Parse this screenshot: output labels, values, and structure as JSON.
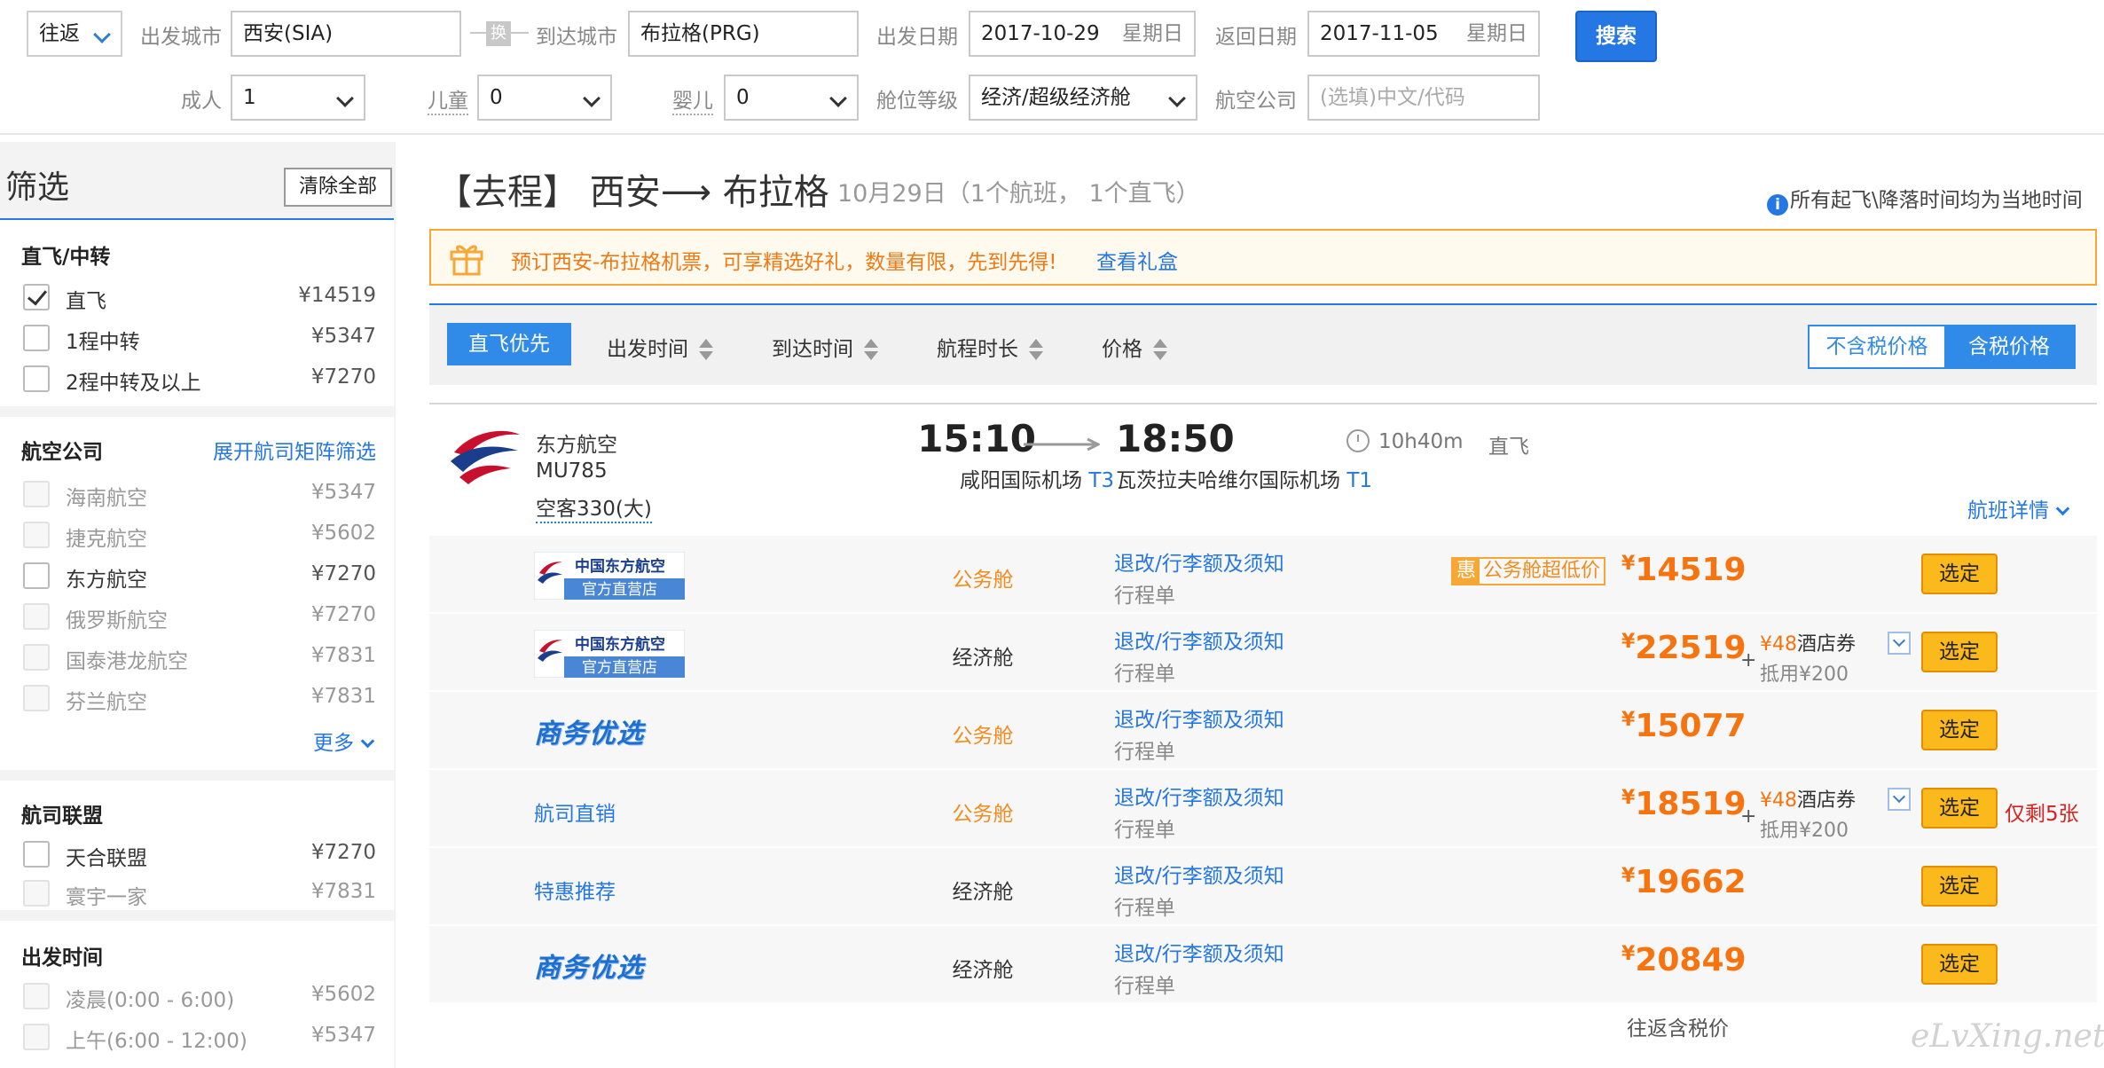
{
  "search": {
    "trip_type": "往返",
    "from_label": "出发城市",
    "from_value": "西安(SIA)",
    "swap_glyph": "换",
    "to_label": "到达城市",
    "to_value": "布拉格(PRG)",
    "depart_label": "出发日期",
    "depart_date": "2017-10-29",
    "depart_weekday": "星期日",
    "return_label": "返回日期",
    "return_date": "2017-11-05",
    "return_weekday": "星期日",
    "search_button": "搜索",
    "adult_label": "成人",
    "adult_value": "1",
    "child_label": "儿童",
    "child_value": "0",
    "infant_label": "婴儿",
    "infant_value": "0",
    "cabin_label": "舱位等级",
    "cabin_value": "经济/超级经济舱",
    "airline_label": "航空公司",
    "airline_placeholder": "(选填)中文/代码"
  },
  "sidebar": {
    "title": "筛选",
    "clear_all": "清除全部",
    "stops": {
      "title": "直飞/中转",
      "items": [
        {
          "label": "直飞",
          "price": "¥14519",
          "checked": true
        },
        {
          "label": "1程中转",
          "price": "¥5347",
          "checked": false
        },
        {
          "label": "2程中转及以上",
          "price": "¥7270",
          "checked": false
        }
      ]
    },
    "airlines": {
      "title": "航空公司",
      "link": "展开航司矩阵筛选",
      "items": [
        {
          "label": "海南航空",
          "price": "¥5347"
        },
        {
          "label": "捷克航空",
          "price": "¥5602"
        },
        {
          "label": "东方航空",
          "price": "¥7270"
        },
        {
          "label": "俄罗斯航空",
          "price": "¥7270"
        },
        {
          "label": "国泰港龙航空",
          "price": "¥7831"
        },
        {
          "label": "芬兰航空",
          "price": "¥7831"
        }
      ],
      "more": "更多"
    },
    "alliances": {
      "title": "航司联盟",
      "items": [
        {
          "label": "天合联盟",
          "price": "¥7270"
        },
        {
          "label": "寰宇一家",
          "price": "¥7831"
        }
      ]
    },
    "dep_time": {
      "title": "出发时间",
      "items": [
        {
          "label": "凌晨(0:00 - 6:00)",
          "price": "¥5602"
        },
        {
          "label": "上午(6:00 - 12:00)",
          "price": "¥5347"
        }
      ]
    }
  },
  "main": {
    "route_title": "【去程】 西安⟶ 布拉格",
    "route_sub": "10月29日（1个航班， 1个直飞）",
    "tz_note": "所有起飞\\降落时间均为当地时间",
    "promo_text": "预订西安-布拉格机票，可享精选好礼，数量有限，先到先得!",
    "promo_link": "查看礼盒",
    "sort": {
      "active": "直飞优先",
      "items": [
        "出发时间",
        "到达时间",
        "航程时长",
        "价格"
      ],
      "tax_off": "不含税价格",
      "tax_on": "含税价格"
    }
  },
  "flight": {
    "airline": "东方航空",
    "flight_no": "MU785",
    "aircraft": "空客330(大)",
    "dep_time": "15:10",
    "arr_time": "18:50",
    "dep_airport": "咸阳国际机场",
    "dep_terminal": "T3",
    "arr_airport": "瓦茨拉夫哈维尔国际机场",
    "arr_terminal": "T1",
    "duration": "10h40m",
    "stop_type": "直飞",
    "details": "航班详情",
    "rule_link": "退改/行李额及须知",
    "ticket_note": "行程单",
    "select_label": "选定",
    "currency": "¥",
    "fares": [
      {
        "source": "中国东方航空官方直营店",
        "cabin": "公务舱",
        "price": "14519",
        "badge_hui": "惠",
        "badge_text": "公务舱超低价"
      },
      {
        "source": "中国东方航空官方直营店",
        "cabin": "经济舱",
        "price": "22519",
        "coupon_amount": "¥48",
        "coupon_label": "酒店券",
        "coupon_sub": "抵用¥200"
      },
      {
        "source": "商务优选",
        "cabin": "公务舱",
        "price": "15077"
      },
      {
        "source": "航司直销",
        "cabin": "公务舱",
        "price": "18519",
        "coupon_amount": "¥48",
        "coupon_label": "酒店券",
        "coupon_sub": "抵用¥200",
        "remaining": "仅剩5张"
      },
      {
        "source": "特惠推荐",
        "cabin": "经济舱",
        "price": "19662"
      },
      {
        "source": "商务优选",
        "cabin": "经济舱",
        "price": "20849"
      }
    ],
    "roundtrip_note": "往返含税价"
  },
  "logo_text": {
    "badge_top": "中国东方航空",
    "badge_bottom": "官方直营店"
  },
  "watermark": "eLvXing.net",
  "colors": {
    "accent": "#2577e3",
    "price": "#f7730e",
    "business_cabin": "#f08c1d",
    "select_button": "#fcb91c",
    "airline_red": "#c8102e",
    "airline_blue": "#1a3e8c"
  }
}
